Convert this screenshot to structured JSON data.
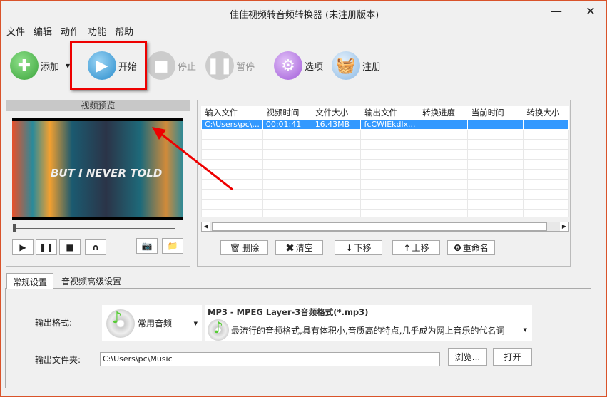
{
  "window": {
    "title": "佳佳视频转音频转换器 (未注册版本)",
    "minimize": "—",
    "close": "✕"
  },
  "menu": [
    "文件",
    "编辑",
    "动作",
    "功能",
    "帮助"
  ],
  "toolbar": {
    "add": "添加",
    "start": "开始",
    "stop": "停止",
    "pause": "暂停",
    "options": "选项",
    "register": "注册"
  },
  "preview": {
    "title": "视频预览",
    "overlay_text": "BUT I NEVER TOLD"
  },
  "table": {
    "columns": [
      "输入文件",
      "视频时间",
      "文件大小",
      "输出文件",
      "转换进度",
      "当前时间",
      "转换大小"
    ],
    "rows": [
      [
        "C:\\Users\\pc\\...",
        "00:01:41",
        "16.43MB",
        "fcCWIEkdlx...",
        "",
        "",
        ""
      ]
    ]
  },
  "actions": {
    "delete": "删除",
    "clear": "清空",
    "down": "下移",
    "up": "上移",
    "rename": "重命名"
  },
  "tabs": [
    "常规设置",
    "音视频高级设置"
  ],
  "settings": {
    "format_label": "输出格式:",
    "category": "常用音频",
    "format_title": "MP3 - MPEG Layer-3音频格式(*.mp3)",
    "format_desc": "最流行的音频格式,具有体积小,音质高的特点,几乎成为网上音乐的代名词",
    "folder_label": "输出文件夹:",
    "folder_value": "C:\\Users\\pc\\Music",
    "browse": "浏览...",
    "open": "打开"
  },
  "colors": {
    "accent": "#3399ff",
    "highlight": "#e00000"
  }
}
